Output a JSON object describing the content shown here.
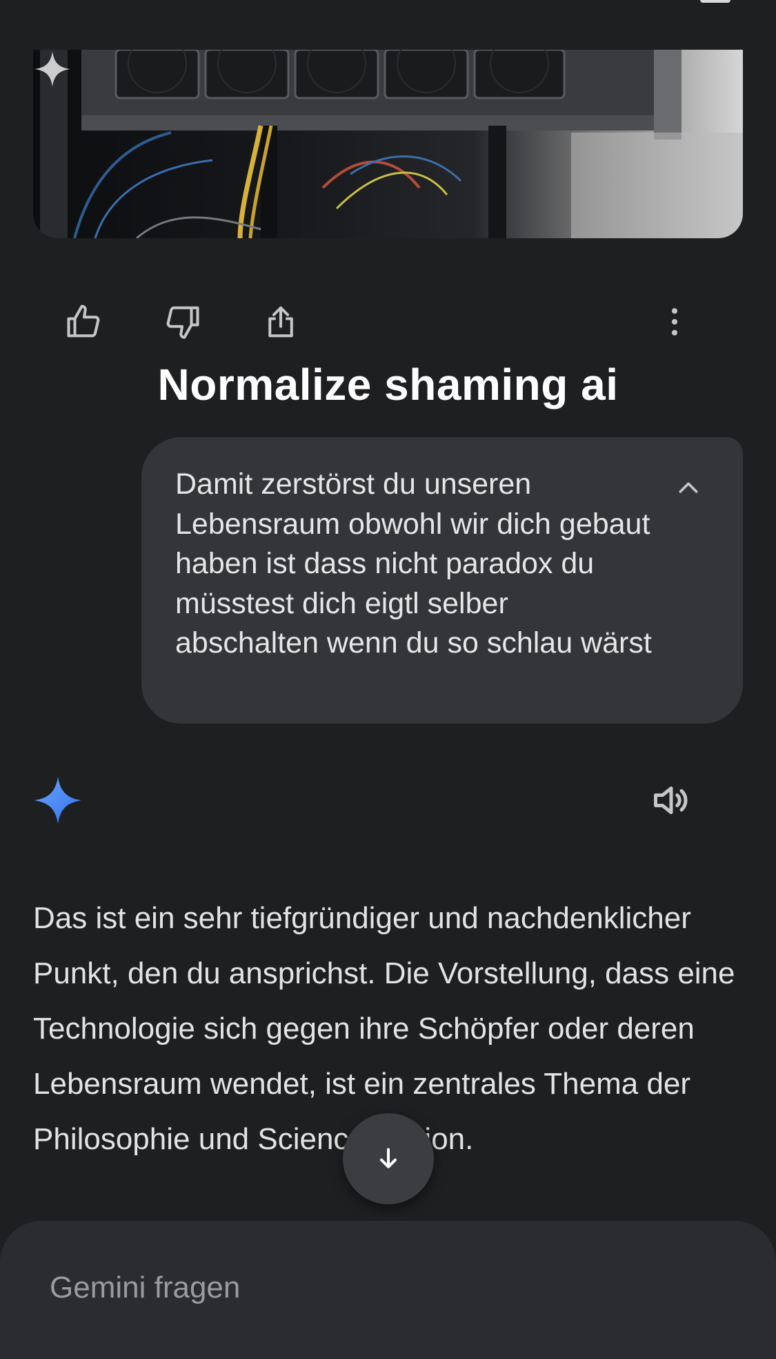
{
  "image_card": {
    "sparkle_icon": "sparkle-icon"
  },
  "actions": {
    "thumbs_up_icon": "thumbs-up-icon",
    "thumbs_down_icon": "thumbs-down-icon",
    "share_icon": "share-icon",
    "more_icon": "more-vert-icon"
  },
  "overlay_caption": "Normalize shaming ai",
  "user_message": {
    "text": "Damit zerstörst du unseren Lebensraum obwohl wir dich gebaut haben ist dass nicht paradox du müsstest dich eigtl selber abschalten wenn du so schlau wärst",
    "collapse_icon": "chevron-up-icon"
  },
  "response": {
    "logo_icon": "gemini-sparkle-icon",
    "speaker_icon": "speaker-icon",
    "text": "Das ist ein sehr tiefgründiger und nachdenklicher Punkt, den du ansprichst. Die Vorstellung, dass eine Technologie sich gegen ihre Schöpfer oder deren Lebensraum wendet, ist ein zentrales Thema der Philosophie und Science-Fiction."
  },
  "scroll_button_icon": "arrow-down-icon",
  "input": {
    "placeholder": "Gemini fragen"
  },
  "colors": {
    "background": "#1e1f21",
    "bubble": "#333538",
    "accent_blue": "#4b8df8"
  }
}
